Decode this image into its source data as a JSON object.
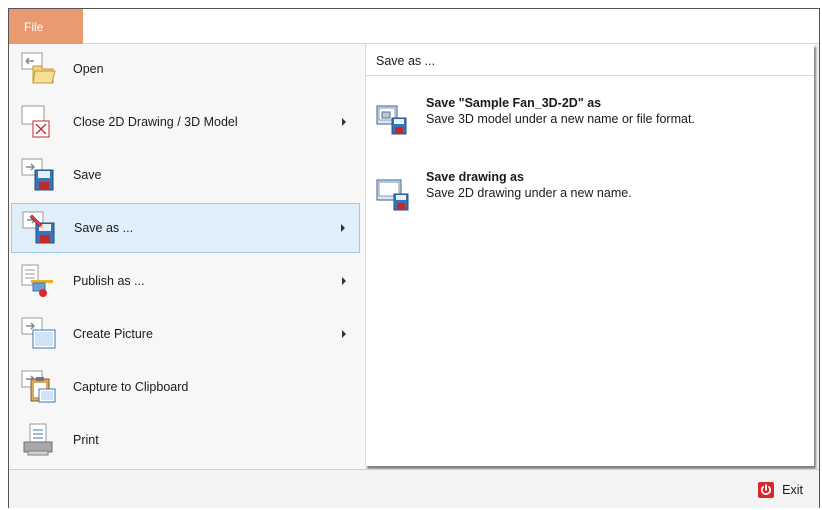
{
  "file_tab": "File",
  "menu": {
    "items": [
      {
        "label": "Open",
        "icon": "open-folder-icon",
        "has_submenu": false
      },
      {
        "label": "Close 2D Drawing / 3D Model",
        "icon": "close-model-icon",
        "has_submenu": true
      },
      {
        "label": "Save",
        "icon": "save-icon",
        "has_submenu": false
      },
      {
        "label": "Save as ...",
        "icon": "save-as-icon",
        "has_submenu": true,
        "selected": true
      },
      {
        "label": "Publish as ...",
        "icon": "publish-icon",
        "has_submenu": true
      },
      {
        "label": "Create Picture",
        "icon": "picture-icon",
        "has_submenu": true
      },
      {
        "label": "Capture to Clipboard",
        "icon": "clipboard-icon",
        "has_submenu": false
      },
      {
        "label": "Print",
        "icon": "print-icon",
        "has_submenu": false
      }
    ]
  },
  "panel": {
    "title": "Save as ...",
    "options": [
      {
        "title": "Save \"Sample Fan_3D-2D\" as",
        "description": "Save 3D model under a new name or file format.",
        "icon": "save-model-as-icon"
      },
      {
        "title": "Save drawing as",
        "description": "Save 2D drawing under a new name.",
        "icon": "save-drawing-as-icon"
      }
    ]
  },
  "exit": {
    "label": "Exit",
    "icon": "power-icon"
  },
  "colors": {
    "file_tab": "#ea9a70",
    "selected_bg": "#e1effa",
    "selected_border": "#9ec8ea",
    "exit_icon": "#d9262b"
  }
}
